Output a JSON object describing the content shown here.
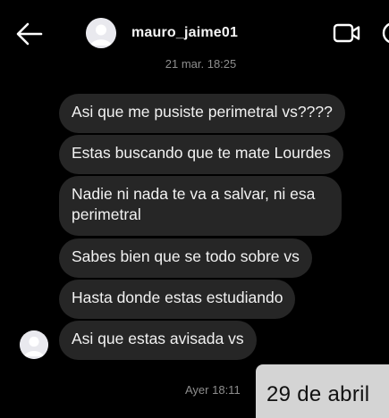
{
  "header": {
    "username": "mauro_jaime01",
    "back_icon": "back-arrow-icon",
    "video_icon": "video-call-icon",
    "info_icon": "info-icon"
  },
  "chat": {
    "timestamp_top": "21 mar. 18:25",
    "messages": [
      "Asi que me pusiste perimetral vs????",
      "Estas buscando que te mate Lourdes",
      "Nadie ni nada te va a salvar, ni esa perimetral",
      "Sabes bien que se todo sobre vs",
      "Hasta donde estas estudiando",
      "Asi que estas avisada vs"
    ],
    "timestamp_bottom": "Ayer 18:11",
    "shared_card_text": "29 de abril"
  },
  "colors": {
    "background": "#000000",
    "bubble": "#262626",
    "timestamp": "#8e8e8e",
    "card": "#d4d4d4"
  }
}
